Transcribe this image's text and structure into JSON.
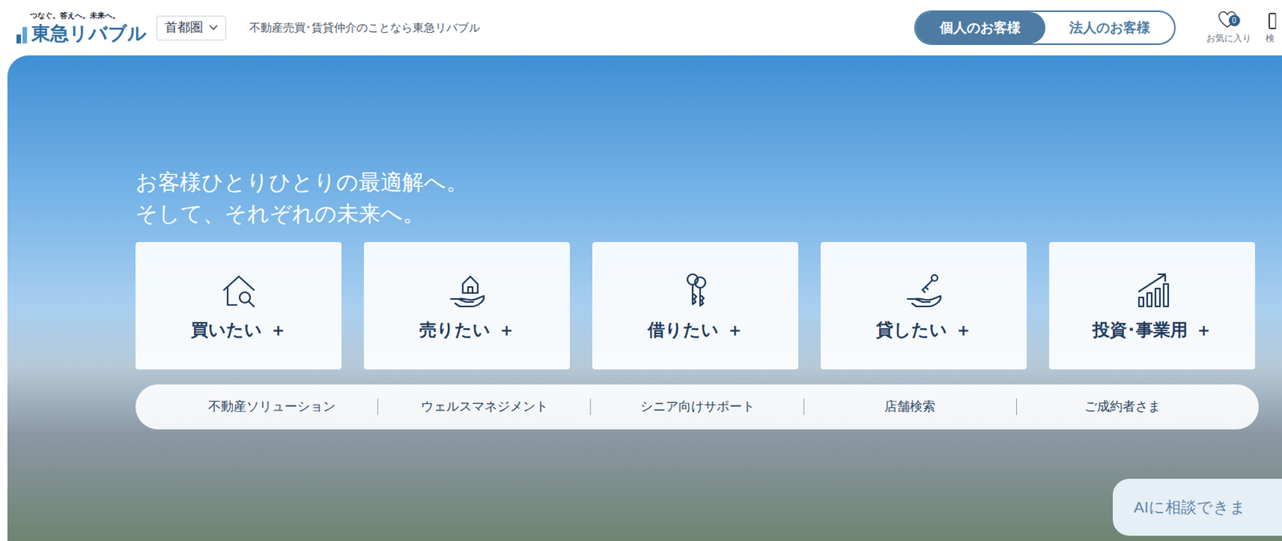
{
  "header": {
    "logo": {
      "tagline": "つなぐ。答えへ。未来へ。",
      "name": "東急リバブル"
    },
    "region": {
      "label": "首都圏"
    },
    "description": "不動産売買･賃貸仲介のことなら東急リバブル",
    "audience_tabs": [
      {
        "label": "個人のお客様",
        "selected": true
      },
      {
        "label": "法人のお客様",
        "selected": false
      }
    ],
    "favorites": {
      "label": "お気に入り",
      "count": "0"
    },
    "search": {
      "label": "検"
    }
  },
  "hero": {
    "headline": [
      "お客様ひとりひとりの最適解へ。",
      "そして、それぞれの未来へ。"
    ],
    "categories": [
      {
        "label": "買いたい",
        "toggle": "＋",
        "expanded": false
      },
      {
        "label": "売りたい",
        "toggle": "＋",
        "expanded": false
      },
      {
        "label": "借りたい",
        "toggle": "＋",
        "expanded": false
      },
      {
        "label": "貸したい",
        "toggle": "＋",
        "expanded": false
      },
      {
        "label": "投資･事業用",
        "toggle": "＋",
        "expanded": false
      }
    ],
    "links": [
      "不動産ソリューション",
      "ウェルスマネジメント",
      "シニア向けサポート",
      "店舗検索",
      "ご成約者さま"
    ]
  },
  "ai_chat": {
    "label": "AIに相談できま"
  }
}
